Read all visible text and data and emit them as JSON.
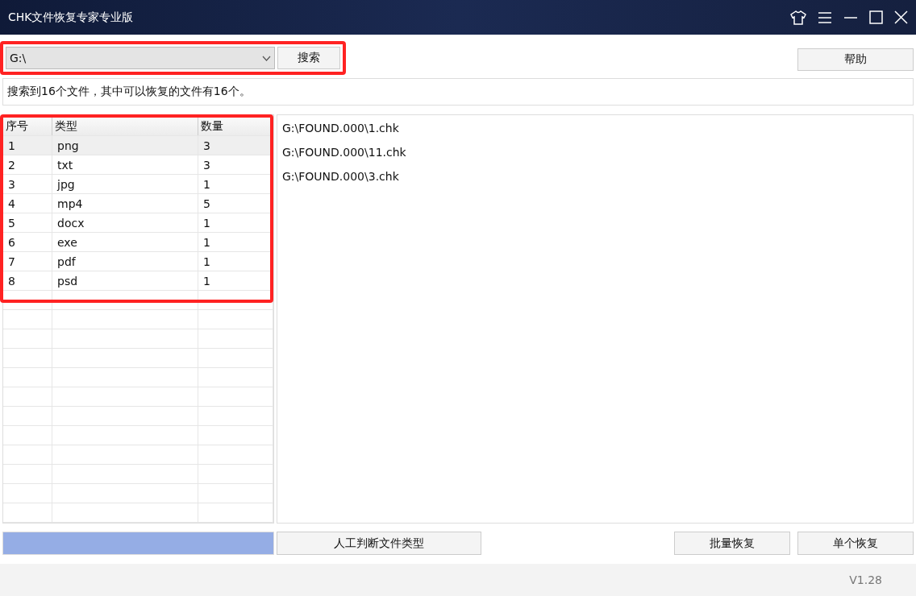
{
  "window": {
    "title": "CHK文件恢复专家专业版"
  },
  "toolbar": {
    "drive": "G:\\",
    "search_button": "搜索",
    "help_button": "帮助"
  },
  "status_message": "搜索到16个文件，其中可以恢复的文件有16个。",
  "type_table": {
    "columns": [
      "序号",
      "类型",
      "数量"
    ],
    "rows": [
      {
        "cells": [
          "1",
          "png",
          "3"
        ],
        "selected": true
      },
      {
        "cells": [
          "2",
          "txt",
          "3"
        ],
        "selected": false
      },
      {
        "cells": [
          "3",
          "jpg",
          "1"
        ],
        "selected": false
      },
      {
        "cells": [
          "4",
          "mp4",
          "5"
        ],
        "selected": false
      },
      {
        "cells": [
          "5",
          "docx",
          "1"
        ],
        "selected": false
      },
      {
        "cells": [
          "6",
          "exe",
          "1"
        ],
        "selected": false
      },
      {
        "cells": [
          "7",
          "pdf",
          "1"
        ],
        "selected": false
      },
      {
        "cells": [
          "8",
          "psd",
          "1"
        ],
        "selected": false
      }
    ]
  },
  "file_list": [
    "G:\\FOUND.000\\1.chk",
    "G:\\FOUND.000\\11.chk",
    "G:\\FOUND.000\\3.chk"
  ],
  "progress": {
    "level": 1
  },
  "actions": {
    "manual_type": "人工判断文件类型",
    "batch_restore": "批量恢复",
    "single_restore": "单个恢复"
  },
  "version": "V1.28"
}
